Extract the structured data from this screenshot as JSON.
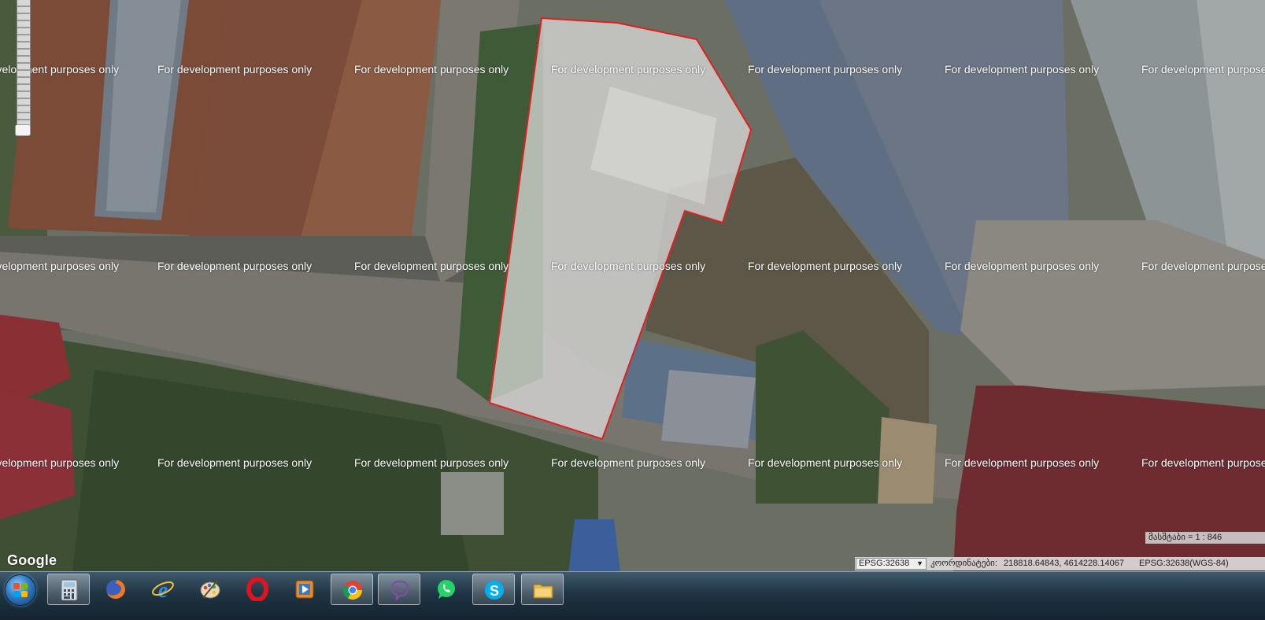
{
  "map": {
    "watermark_text": "For development purposes only",
    "google_logo": "Google",
    "scale_text": "მასშტაბი = 1 : 846",
    "status_bar": {
      "epsg_selected": "EPSG:32638",
      "coordinates_label": "კოორდინატები:",
      "coordinates_value": "218818.64843, 4614228.14067",
      "epsg_info": "EPSG:32638(WGS-84)"
    },
    "selection_polygon_color": "#e02020"
  },
  "taskbar": {
    "items": [
      {
        "name": "start-button",
        "icon": "windows-logo-icon"
      },
      {
        "name": "calculator",
        "icon": "calculator-icon"
      },
      {
        "name": "firefox",
        "icon": "firefox-icon"
      },
      {
        "name": "internet-explorer",
        "icon": "internet-explorer-icon"
      },
      {
        "name": "paint",
        "icon": "paint-palette-icon"
      },
      {
        "name": "opera",
        "icon": "opera-icon"
      },
      {
        "name": "media-player",
        "icon": "media-player-icon"
      },
      {
        "name": "chrome",
        "icon": "chrome-icon"
      },
      {
        "name": "viber",
        "icon": "viber-icon"
      },
      {
        "name": "whatsapp",
        "icon": "whatsapp-icon"
      },
      {
        "name": "skype",
        "icon": "skype-icon"
      },
      {
        "name": "file-explorer",
        "icon": "folder-icon"
      }
    ]
  }
}
